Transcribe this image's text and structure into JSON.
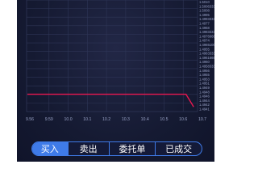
{
  "tabs": [
    {
      "label": "买入",
      "active": true
    },
    {
      "label": "卖出",
      "active": false
    },
    {
      "label": "委托单",
      "active": false
    },
    {
      "label": "已成交",
      "active": false
    }
  ],
  "colors": {
    "panel_bg": "#151a32",
    "grid": "#2e3556",
    "axis_text": "#9aa3c7",
    "line": "#e8174f",
    "tab_accent": "#3f7be8"
  },
  "chart_data": {
    "type": "line",
    "x_ticks": [
      "9.56",
      "9.59",
      "10.0",
      "10.1",
      "10.2",
      "10.3",
      "10.4",
      "10.5",
      "10.6",
      "10.7"
    ],
    "y_ticks": [
      "1.5010",
      "1.50063333",
      "1.5008",
      "1.4995",
      "1.49933333",
      "1.4977",
      "1.4968",
      "1.49833333",
      "1.49766666",
      "1.4974",
      "1.49651000",
      "1.4955",
      "1.49633333",
      "1.49616666",
      "1.4960",
      "1.49583333",
      "1.4956",
      "1.4955",
      "1.4953",
      "1.4951",
      "1.4949",
      "1.4948",
      "1.4946",
      "1.4944",
      "1.4942",
      "1.4941"
    ],
    "series": [
      {
        "x": [
          9.56,
          10.59,
          10.64
        ],
        "y": [
          1.495,
          1.495,
          1.4942
        ]
      }
    ],
    "ylim": [
      1.4939,
      1.501
    ],
    "xlim": [
      9.555,
      10.665
    ],
    "grid": true,
    "legend": "none"
  }
}
